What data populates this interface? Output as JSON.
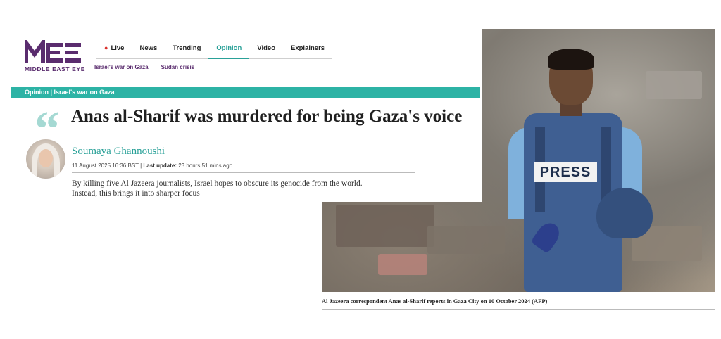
{
  "logo": {
    "mark": "MEE",
    "name": "MIDDLE EAST EYE"
  },
  "nav": {
    "items": [
      "Live",
      "News",
      "Trending",
      "Opinion",
      "Video",
      "Explainers"
    ],
    "active": "Opinion"
  },
  "subnav": [
    "Israel's war on Gaza",
    "Sudan crisis"
  ],
  "section": "Opinion | Israel's war on Gaza",
  "article": {
    "headline": "Anas al-Sharif was murdered for being Gaza's voice",
    "author": "Soumaya Ghannoushi",
    "date": "11 August 2025 16:36 BST",
    "update_label": "Last update:",
    "update_value": "23 hours 51 mins ago",
    "standfirst_line1": "By killing five Al Jazeera journalists, Israel hopes to obscure its genocide from the world.",
    "standfirst_line2": "Instead, this brings it into sharper focus"
  },
  "photo": {
    "vest_label": "PRESS",
    "caption": "Al Jazeera correspondent Anas al-Sharif reports in Gaza City on 10 October 2024 (AFP)"
  },
  "colors": {
    "brand_purple": "#5a2c6e",
    "accent_teal": "#2aa198",
    "bar_teal": "#2db3a5",
    "live_red": "#d9302b"
  }
}
